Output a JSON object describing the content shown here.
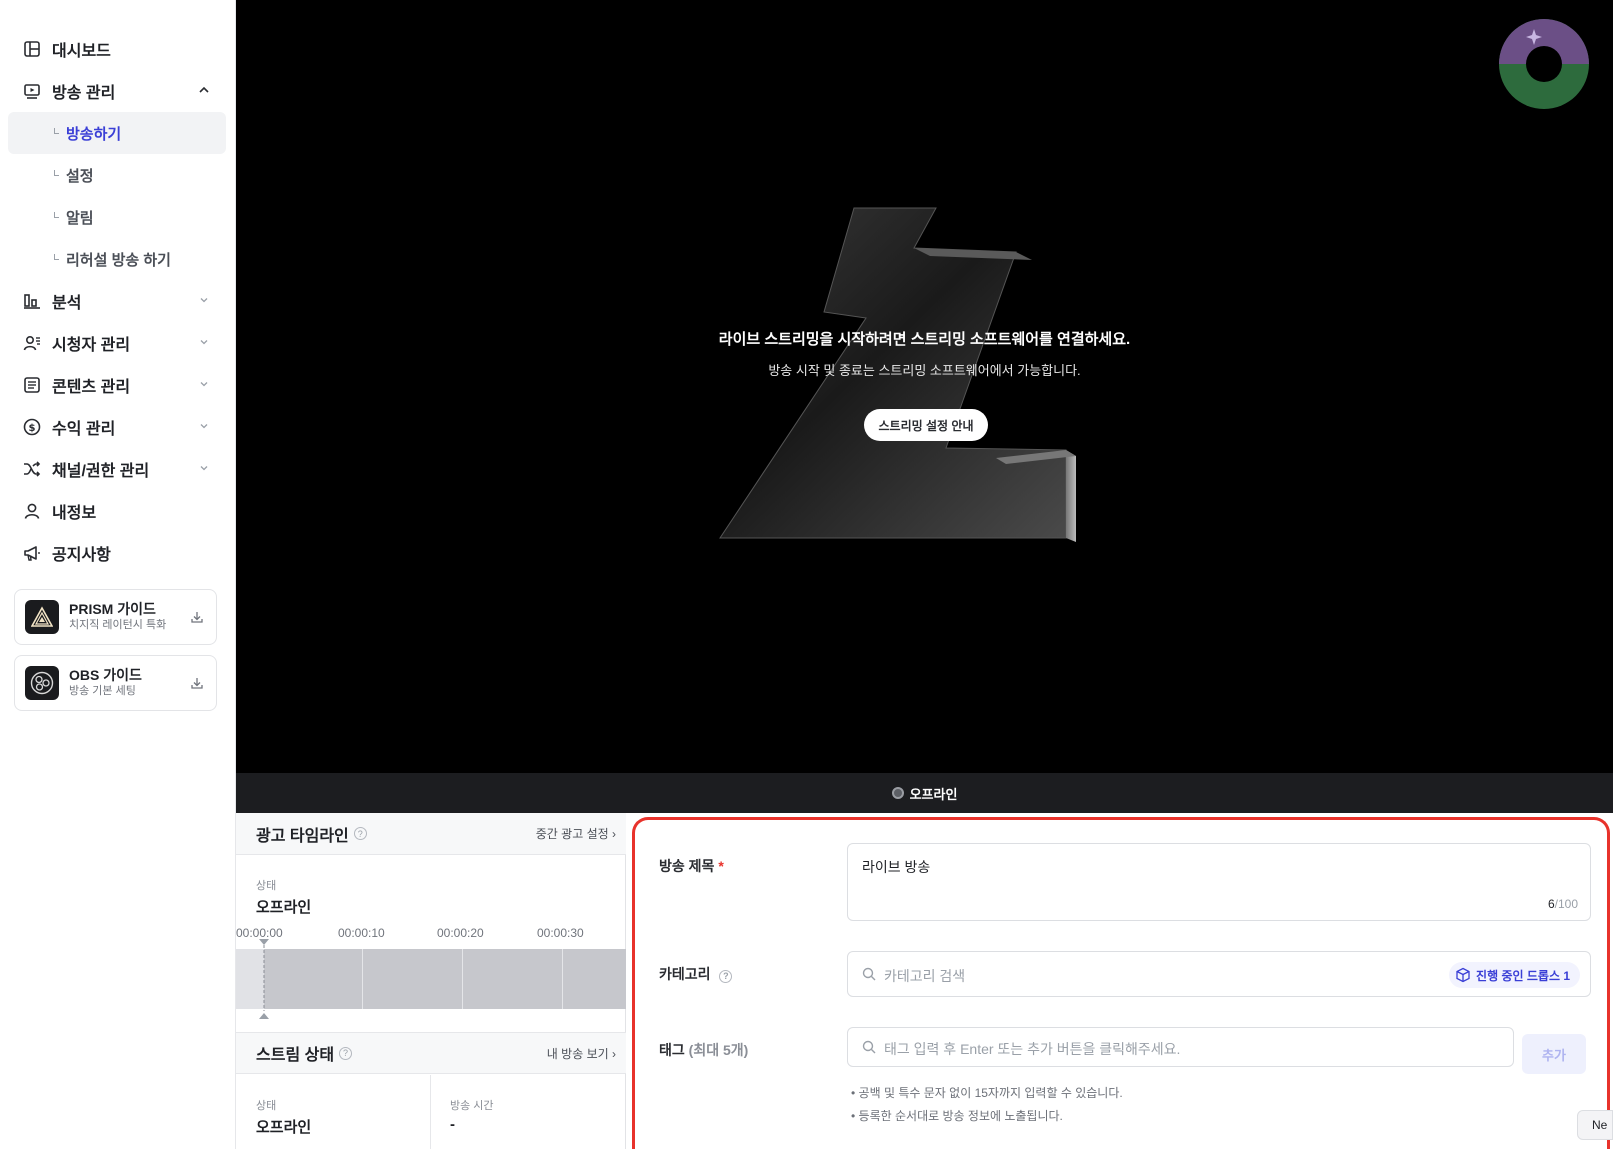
{
  "sidebar": {
    "items": [
      {
        "label": "대시보드",
        "icon": "dashboard-icon"
      },
      {
        "label": "방송 관리",
        "icon": "broadcast-icon",
        "expanded": true,
        "children": [
          "방송하기",
          "설정",
          "알림",
          "리허설 방송 하기"
        ]
      },
      {
        "label": "분석",
        "icon": "chart-icon"
      },
      {
        "label": "시청자 관리",
        "icon": "viewers-icon"
      },
      {
        "label": "콘텐츠 관리",
        "icon": "content-icon"
      },
      {
        "label": "수익 관리",
        "icon": "dollar-icon"
      },
      {
        "label": "채널/권한 관리",
        "icon": "shuffle-icon"
      },
      {
        "label": "내정보",
        "icon": "user-icon"
      },
      {
        "label": "공지사항",
        "icon": "megaphone-icon"
      }
    ],
    "active_child": "방송하기",
    "guides": [
      {
        "title": "PRISM 가이드",
        "subtitle": "치지직 레이턴시 특화"
      },
      {
        "title": "OBS 가이드",
        "subtitle": "방송 기본 세팅"
      }
    ]
  },
  "video": {
    "title": "라이브 스트리밍을 시작하려면 스트리밍 소프트웨어를 연결하세요.",
    "subtitle": "방송 시작 및 종료는 스트리밍 소프트웨어에서 가능합니다.",
    "button": "스트리밍 설정 안내"
  },
  "status_bar": {
    "label": "오프라인"
  },
  "ad_timeline": {
    "title": "광고 타임라인",
    "link": "중간 광고 설정",
    "status_label": "상태",
    "status_value": "오프라인",
    "ticks": [
      "00:00:00",
      "00:00:10",
      "00:00:20",
      "00:00:30"
    ]
  },
  "stream_status": {
    "title": "스트림 상태",
    "link": "내 방송 보기",
    "status_label": "상태",
    "status_value": "오프라인",
    "time_label": "방송 시간",
    "time_value": "-"
  },
  "form": {
    "title_label": "방송 제목",
    "title_required": "*",
    "title_value": "라이브 방송",
    "title_count": "6",
    "title_max": "/100",
    "category_label": "카테고리",
    "category_placeholder": "카테고리 검색",
    "drops_badge": "진행 중인 드롭스 1",
    "tag_label": "태그",
    "tag_label_extra": "(최대 5개)",
    "tag_placeholder": "태그 입력 후 Enter 또는 추가 버튼을 클릭해주세요.",
    "add_button": "추가",
    "hints": [
      "• 공백 및 특수 문자 없이 15자까지 입력할 수 있습니다.",
      "• 등록한 순서대로 방송 정보에 노출됩니다."
    ]
  },
  "corner_button": "Ne",
  "colors": {
    "accent": "#3a3fd6",
    "highlight": "#e8322b",
    "video_bg": "#000000"
  }
}
